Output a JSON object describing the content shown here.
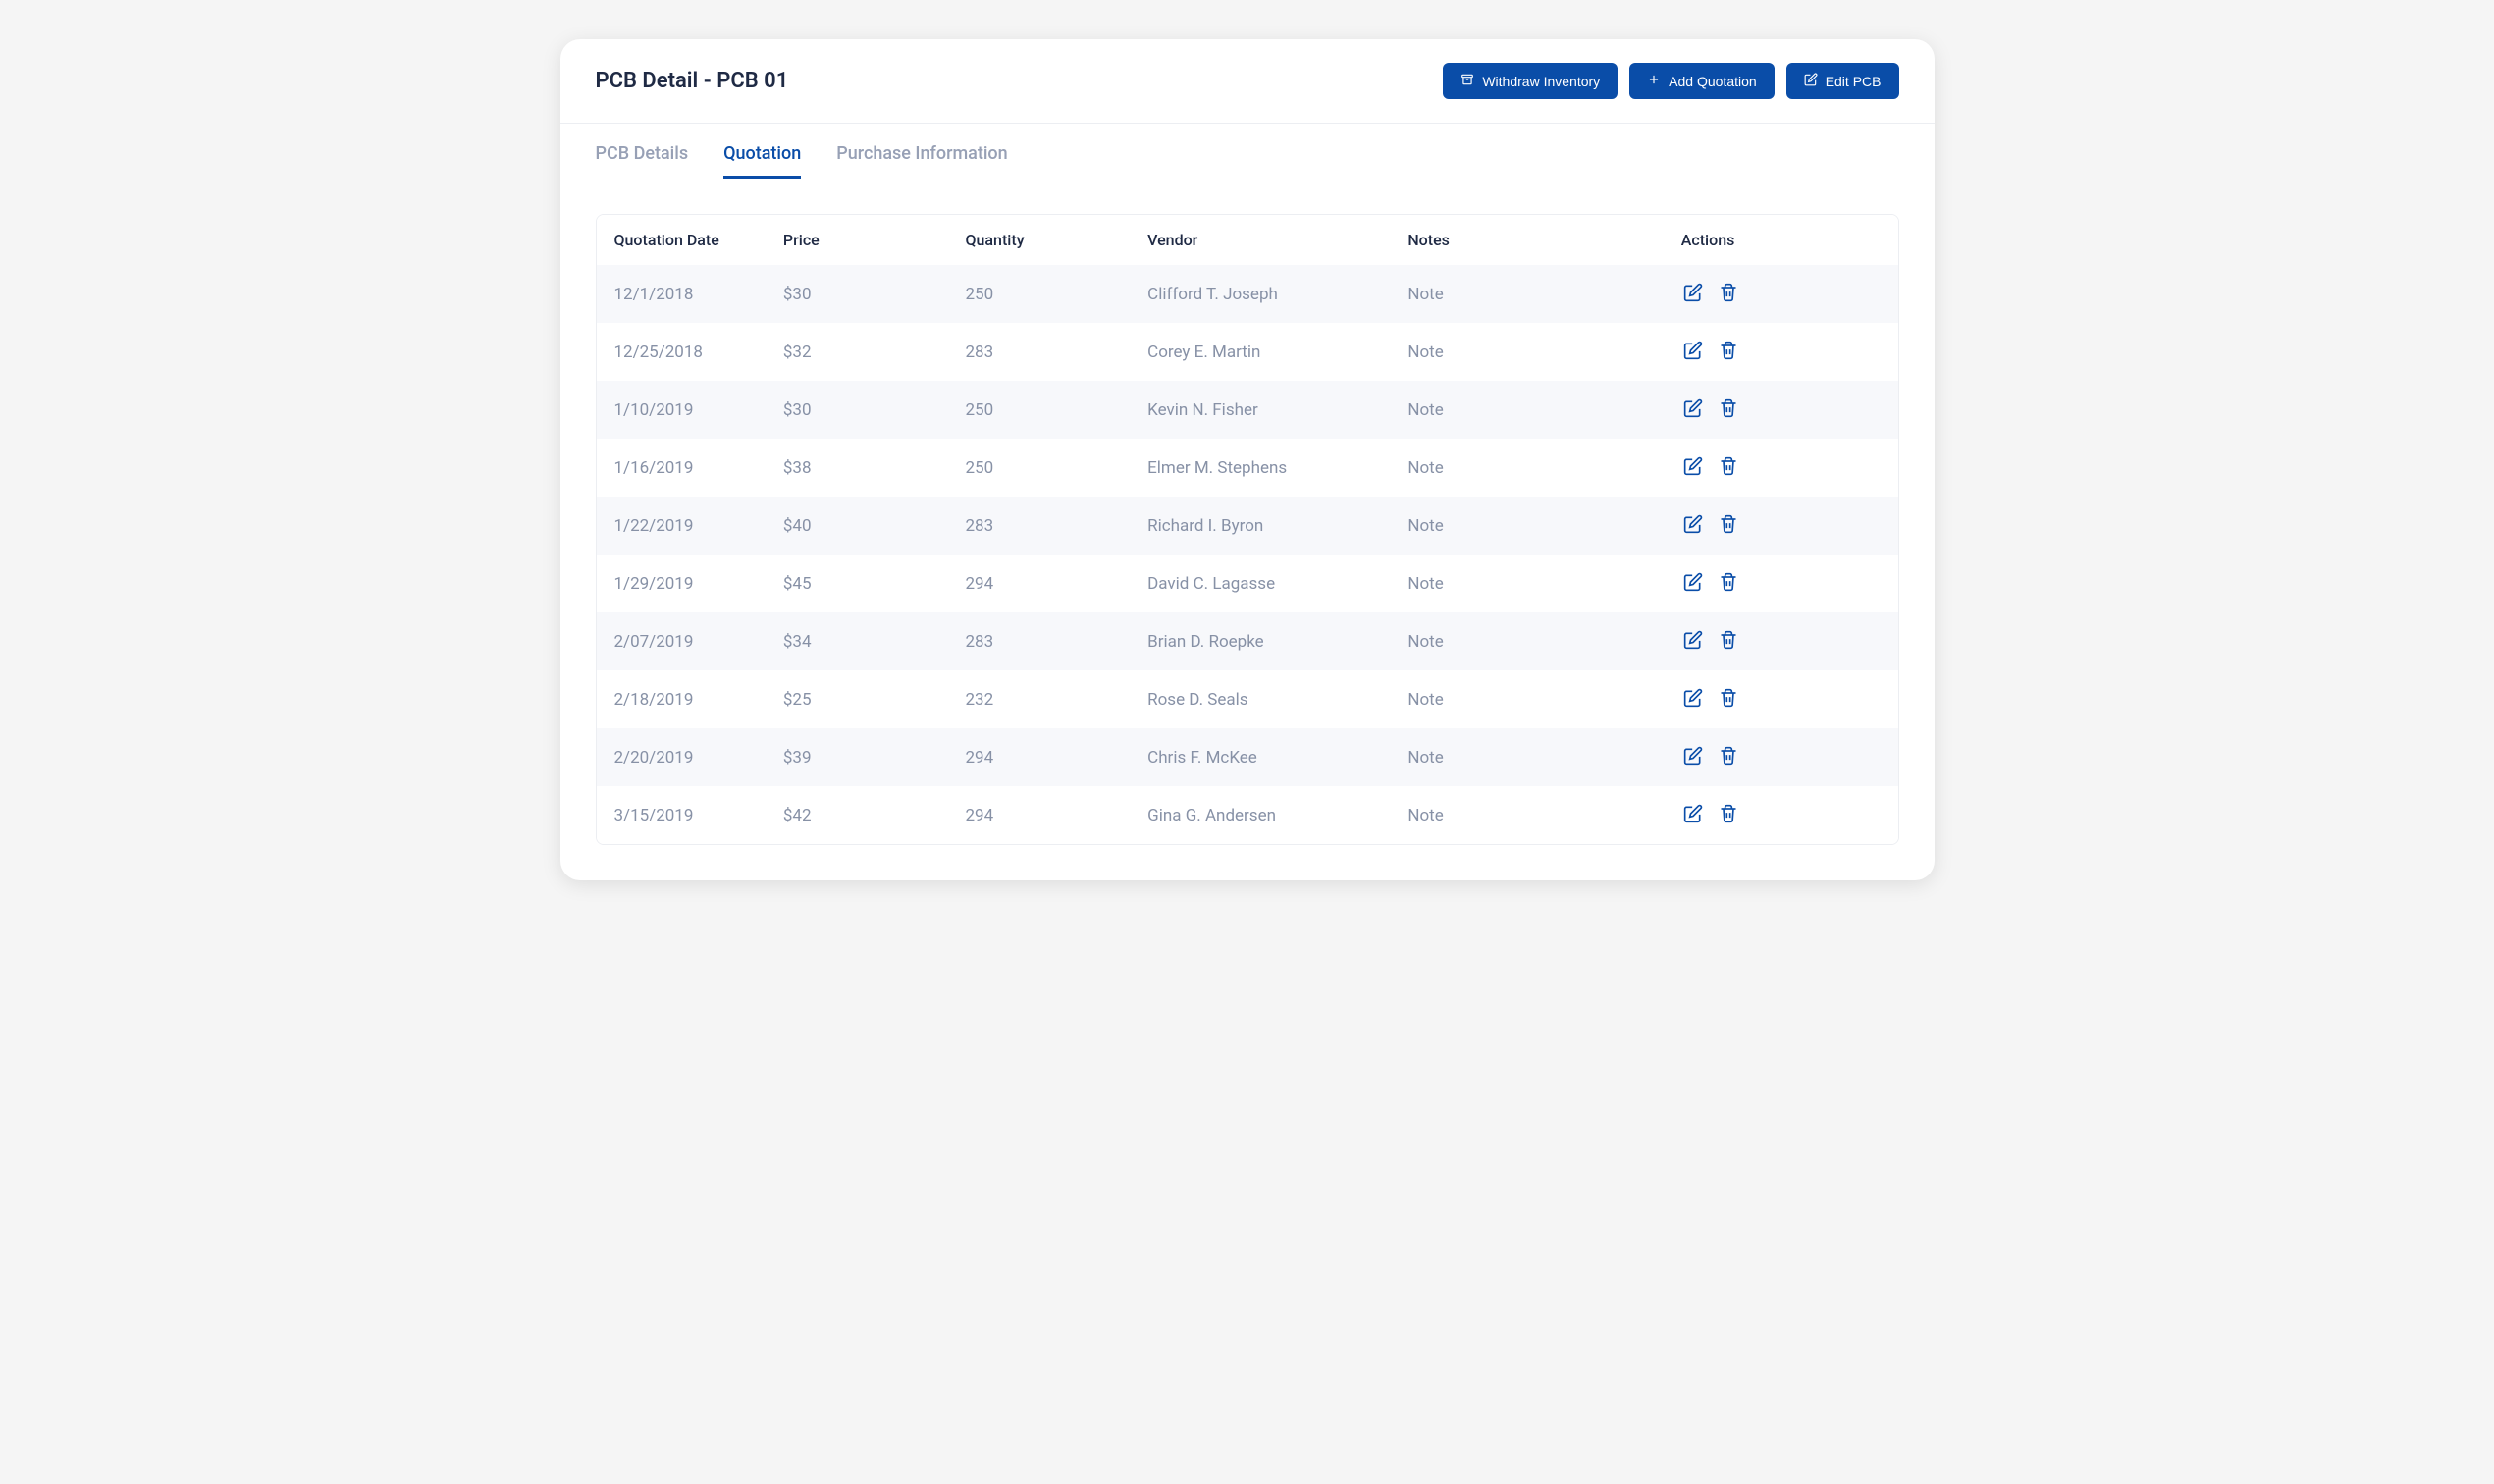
{
  "page_title": "PCB Detail - PCB 01",
  "buttons": {
    "withdraw": "Withdraw Inventory",
    "add_quotation": "Add Quotation",
    "edit_pcb": "Edit PCB"
  },
  "tabs": [
    {
      "label": "PCB Details",
      "active": false
    },
    {
      "label": "Quotation",
      "active": true
    },
    {
      "label": "Purchase Information",
      "active": false
    }
  ],
  "table": {
    "headers": {
      "date": "Quotation Date",
      "price": "Price",
      "quantity": "Quantity",
      "vendor": "Vendor",
      "notes": "Notes",
      "actions": "Actions"
    },
    "rows": [
      {
        "date": "12/1/2018",
        "price": "$30",
        "quantity": "250",
        "vendor": "Clifford T. Joseph",
        "notes": "Note"
      },
      {
        "date": "12/25/2018",
        "price": "$32",
        "quantity": "283",
        "vendor": "Corey E. Martin",
        "notes": "Note"
      },
      {
        "date": "1/10/2019",
        "price": "$30",
        "quantity": "250",
        "vendor": "Kevin N. Fisher",
        "notes": "Note"
      },
      {
        "date": "1/16/2019",
        "price": "$38",
        "quantity": "250",
        "vendor": "Elmer M. Stephens",
        "notes": "Note"
      },
      {
        "date": "1/22/2019",
        "price": "$40",
        "quantity": "283",
        "vendor": "Richard I. Byron",
        "notes": "Note"
      },
      {
        "date": "1/29/2019",
        "price": "$45",
        "quantity": "294",
        "vendor": "David C. Lagasse",
        "notes": "Note"
      },
      {
        "date": "2/07/2019",
        "price": "$34",
        "quantity": "283",
        "vendor": "Brian D. Roepke",
        "notes": "Note"
      },
      {
        "date": "2/18/2019",
        "price": "$25",
        "quantity": "232",
        "vendor": "Rose D. Seals",
        "notes": "Note"
      },
      {
        "date": "2/20/2019",
        "price": "$39",
        "quantity": "294",
        "vendor": "Chris F. McKee",
        "notes": "Note"
      },
      {
        "date": "3/15/2019",
        "price": "$42",
        "quantity": "294",
        "vendor": "Gina G. Andersen",
        "notes": "Note"
      }
    ]
  }
}
